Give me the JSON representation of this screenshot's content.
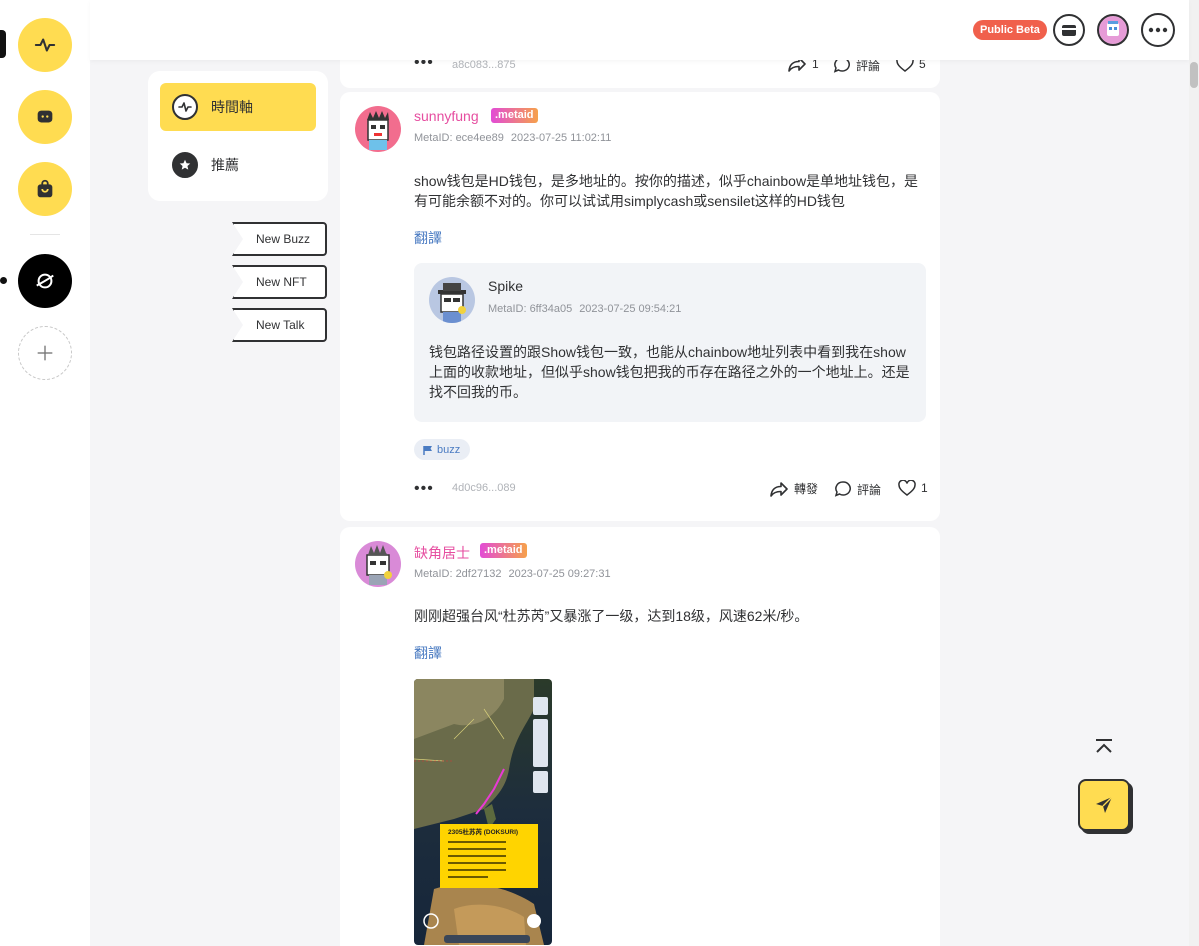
{
  "topbar": {
    "beta_label": "Public Beta"
  },
  "sidebar": {
    "items": [
      {
        "name": "timeline-icon"
      },
      {
        "name": "chat-icon"
      },
      {
        "name": "shop-icon"
      },
      {
        "name": "metaid-app-icon"
      },
      {
        "name": "add-icon"
      }
    ]
  },
  "menu": {
    "items": [
      {
        "label": "時間軸",
        "icon": "pulse-icon",
        "active": true
      },
      {
        "label": "推薦",
        "icon": "star-icon",
        "active": false
      }
    ],
    "quick": [
      "New Buzz",
      "New NFT",
      "New Talk"
    ]
  },
  "feed": {
    "post0": {
      "txid": "a8c083...875",
      "forward_count": "1",
      "comment_label": "評論",
      "like_count": "5"
    },
    "post1": {
      "user_name": "sunnyfung",
      "badge": ".metaid",
      "metaid": "MetaID: ece4ee89",
      "time": "2023-07-25 11:02:11",
      "content": "show钱包是HD钱包，是多地址的。按你的描述，似乎chainbow是单地址钱包，是有可能余额不对的。你可以试试用simplycash或sensilet这样的HD钱包",
      "translate": "翻譯",
      "quote": {
        "user_name": "Spike",
        "metaid": "MetaID: 6ff34a05",
        "time": "2023-07-25 09:54:21",
        "content": "钱包路径设置的跟Show钱包一致，也能从chainbow地址列表中看到我在show上面的收款地址，但似乎show钱包把我的币存在路径之外的一个地址上。还是找不回我的币。"
      },
      "tag": "buzz",
      "txid": "4d0c96...089",
      "forward_label": "轉發",
      "comment_label": "評論",
      "like_count": "1"
    },
    "post2": {
      "user_name": "缺角居士",
      "badge": ".metaid",
      "metaid": "MetaID: 2df27132",
      "time": "2023-07-25 09:27:31",
      "content": "刚刚超强台风“杜苏芮”又暴涨了一级，达到18级，风速62米/秒。",
      "translate": "翻譯",
      "image": {
        "popup_title": "2305杜苏芮 (DOKSURI)"
      }
    }
  },
  "colors": {
    "accent": "#ffdc51",
    "brand_pink": "#e64ea0",
    "link": "#4a7bc2",
    "beta": "#f0604c"
  }
}
